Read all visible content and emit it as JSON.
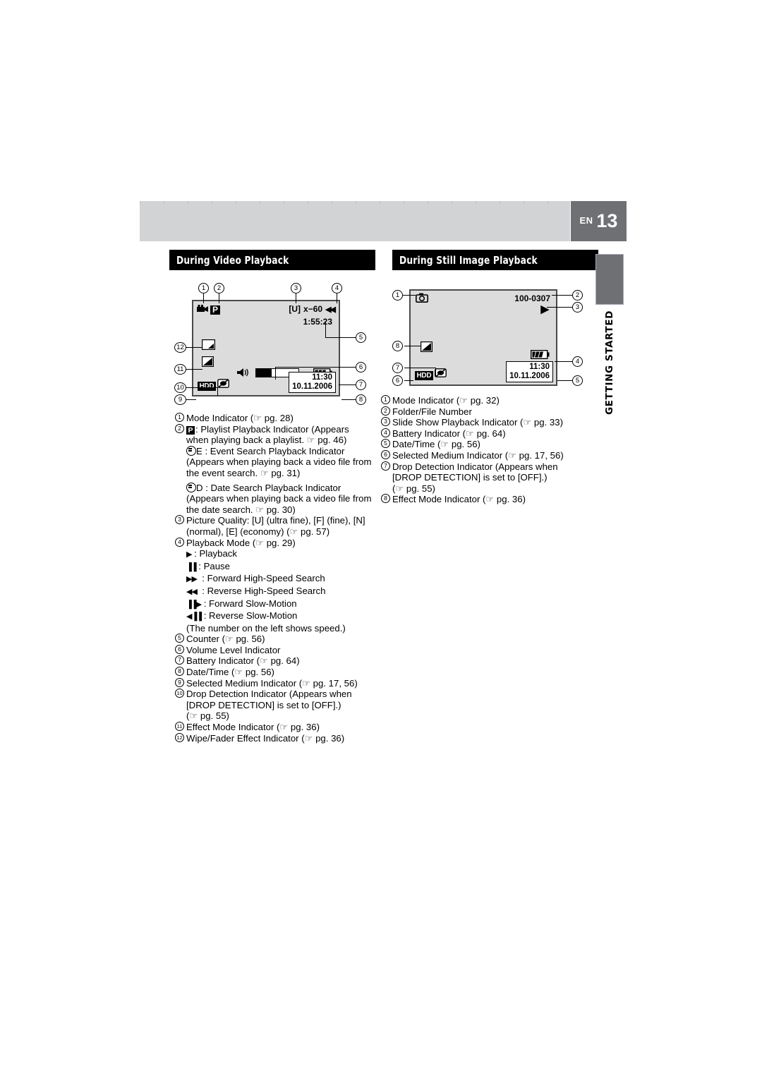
{
  "page": {
    "lang_label": "EN",
    "number": "13",
    "side_tab": "GETTING STARTED"
  },
  "sections": {
    "video": {
      "title": "During Video Playback"
    },
    "still": {
      "title": "During Still Image Playback"
    }
  },
  "video_lcd": {
    "callouts": [
      "1",
      "2",
      "3",
      "4",
      "5",
      "6",
      "7",
      "8",
      "9",
      "10",
      "11",
      "12"
    ],
    "mode_icon": "video-camera-icon",
    "playlist_chip": "P",
    "picture_quality": "[U]",
    "playback_speed": "x−60",
    "playback_glyph": "◀◀",
    "counter": "1:55:23",
    "time": "11:30",
    "date": "10.11.2006",
    "medium_chip": "HDD",
    "speaker_icon": "speaker-icon",
    "battery_icon": "battery-icon",
    "drop_detection_icon": "drop-detection-icon",
    "effect_icon": "effect-mode-icon",
    "wipe_icon": "wipe-fader-icon"
  },
  "still_lcd": {
    "callouts": [
      "1",
      "2",
      "3",
      "4",
      "5",
      "6",
      "7",
      "8"
    ],
    "mode_icon": "still-camera-icon",
    "folder_file_number": "100-0307",
    "slideshow_glyph": "▶",
    "time": "11:30",
    "date": "10.11.2006",
    "medium_chip": "HDD",
    "battery_icon": "battery-icon",
    "drop_detection_icon": "drop-detection-icon",
    "effect_icon": "effect-mode-icon"
  },
  "video_list": {
    "i1": "Mode Indicator (☞ pg. 28)",
    "i2_a": ": Playlist Playback Indicator (Appears",
    "i2_b": "when playing back a playlist. ☞ pg. 46)",
    "i2_c": "E : Event Search Playback Indicator",
    "i2_d": "(Appears when playing back a video file from",
    "i2_e": "the event search. ☞ pg. 31)",
    "i2_f": "D : Date Search Playback Indicator",
    "i2_g": "(Appears when playing back a video file from",
    "i2_h": "the date search. ☞ pg. 30)",
    "i3_a": "Picture Quality: [U] (ultra fine), [F] (fine), [N]",
    "i3_b": "(normal), [E] (economy) (☞ pg. 57)",
    "i4": "Playback Mode (☞ pg. 29)",
    "i4_modes": [
      {
        "glyph": "▶",
        "label": ": Playback"
      },
      {
        "glyph": "▐▐",
        "label": ": Pause"
      },
      {
        "glyph": "▶▶",
        "label": ": Forward High-Speed Search"
      },
      {
        "glyph": "◀◀",
        "label": ": Reverse High-Speed Search"
      },
      {
        "glyph": "▐▐▶",
        "label": ": Forward Slow-Motion"
      },
      {
        "glyph": "◀▐▐",
        "label": ": Reverse Slow-Motion"
      }
    ],
    "i4_note": "(The number on the left shows speed.)",
    "i5": "Counter (☞ pg. 56)",
    "i6": "Volume Level Indicator",
    "i7": "Battery Indicator (☞ pg. 64)",
    "i8": "Date/Time (☞ pg. 56)",
    "i9": "Selected Medium Indicator (☞ pg. 17, 56)",
    "i10_a": "Drop Detection Indicator (Appears when",
    "i10_b": "[DROP DETECTION] is set to [OFF].)",
    "i10_c": "(☞ pg. 55)",
    "i11": "Effect Mode Indicator (☞ pg. 36)",
    "i12": "Wipe/Fader Effect Indicator (☞ pg. 36)"
  },
  "still_list": {
    "i1": "Mode Indicator (☞ pg. 32)",
    "i2": "Folder/File Number",
    "i3": "Slide Show Playback Indicator (☞ pg. 33)",
    "i4": "Battery Indicator (☞ pg. 64)",
    "i5": "Date/Time (☞ pg. 56)",
    "i6": "Selected Medium Indicator (☞ pg. 17, 56)",
    "i7_a": "Drop Detection Indicator (Appears when",
    "i7_b": "[DROP DETECTION] is set to [OFF].)",
    "i7_c": "(☞ pg. 55)",
    "i8": "Effect Mode Indicator (☞ pg. 36)"
  },
  "colors": {
    "header_band": "#d2d3d5",
    "page_tab": "#6e7073",
    "section_bar": "#000000",
    "lcd_screen": "#dcdcdc",
    "lcd_border": "#4a4a4a"
  }
}
